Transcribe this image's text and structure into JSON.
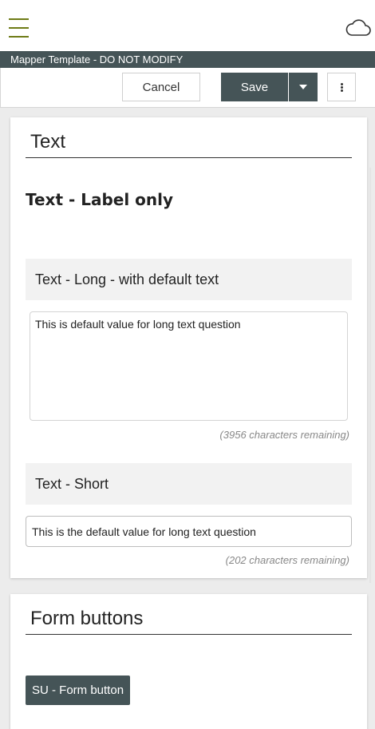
{
  "app": {
    "title": "Mapper Template - DO NOT MODIFY",
    "icons": {
      "menu": "hamburger-icon",
      "sync": "cloud-icon",
      "more": "more-vertical-icon",
      "caret": "caret-down-icon"
    },
    "colors": {
      "accent": "#6e7b16",
      "primary": "#455457"
    }
  },
  "toolbar": {
    "cancel_label": "Cancel",
    "save_label": "Save"
  },
  "sections": [
    {
      "title": "Text",
      "label_only": "Text - Label only",
      "long_question": {
        "label": "Text - Long - with default text",
        "value": "This is default value for long text question",
        "remaining": "(3956 characters remaining)"
      },
      "short_question": {
        "label": "Text - Short",
        "value": "This is the default value for long text question",
        "remaining": "(202 characters remaining)"
      }
    },
    {
      "title": "Form buttons",
      "button_label": "SU - Form button"
    }
  ]
}
